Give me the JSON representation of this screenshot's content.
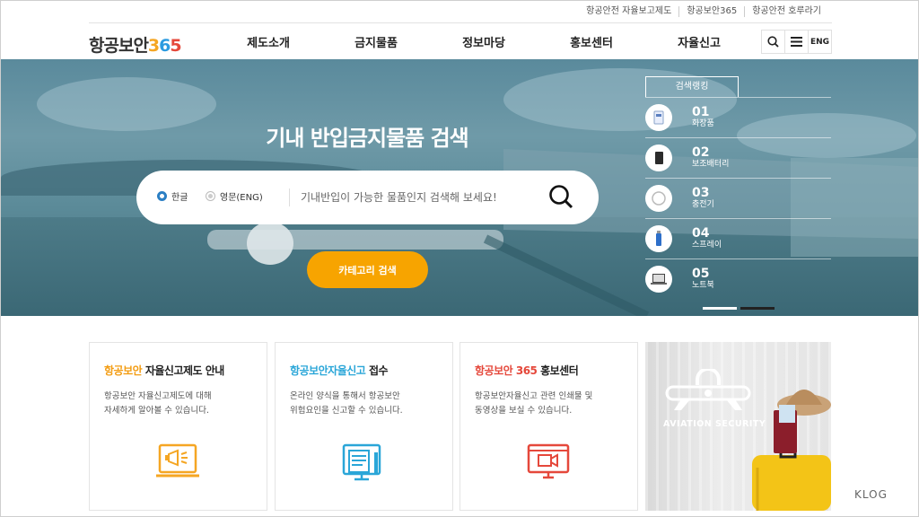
{
  "utility_links": [
    "항공안전 자율보고제도",
    "항공보안365",
    "항공안전 호루라기"
  ],
  "logo": {
    "text": "항공보안",
    "d1": "3",
    "d2": "6",
    "d3": "5"
  },
  "nav": [
    "제도소개",
    "금지물품",
    "정보마당",
    "홍보센터",
    "자율신고"
  ],
  "header_buttons": {
    "lang": "ENG"
  },
  "hero": {
    "title": "기내 반입금지물품 검색",
    "radio_korean": "한글",
    "radio_english": "영문(ENG)",
    "search_placeholder": "기내반입이 가능한 물품인지 검색해 보세요!",
    "category_button": "카테고리 검색"
  },
  "ranking": {
    "title": "검색랭킹",
    "items": [
      {
        "num": "01",
        "name": "화장품",
        "icon": "cosmetics-icon"
      },
      {
        "num": "02",
        "name": "보조배터리",
        "icon": "power-bank-icon"
      },
      {
        "num": "03",
        "name": "충전기",
        "icon": "charger-icon"
      },
      {
        "num": "04",
        "name": "스프레이",
        "icon": "spray-icon"
      },
      {
        "num": "05",
        "name": "노트북",
        "icon": "laptop-icon"
      }
    ]
  },
  "cards": [
    {
      "hl": "항공보안",
      "rest": " 자율신고제도 안내",
      "hl_color": "#f39c12",
      "line1": "항공보안 자율신고제도에 대해",
      "line2": "자세하게 알아볼 수 있습니다."
    },
    {
      "hl": "항공보안자율신고",
      "rest": " 접수",
      "hl_color": "#2aa6d8",
      "line1": "온라인 양식을 통해서 항공보안",
      "line2": "위험요인을 신고할 수 있습니다."
    },
    {
      "hl": "항공보안 365",
      "rest": " 홍보센터",
      "hl_color": "#e5483b",
      "line1": "항공보안자율신고 관련 인쇄물 및",
      "line2": "동영상을 보실 수 있습니다."
    }
  ],
  "photo_caption": "AVIATION SECURITY",
  "watermark": "KLOG"
}
